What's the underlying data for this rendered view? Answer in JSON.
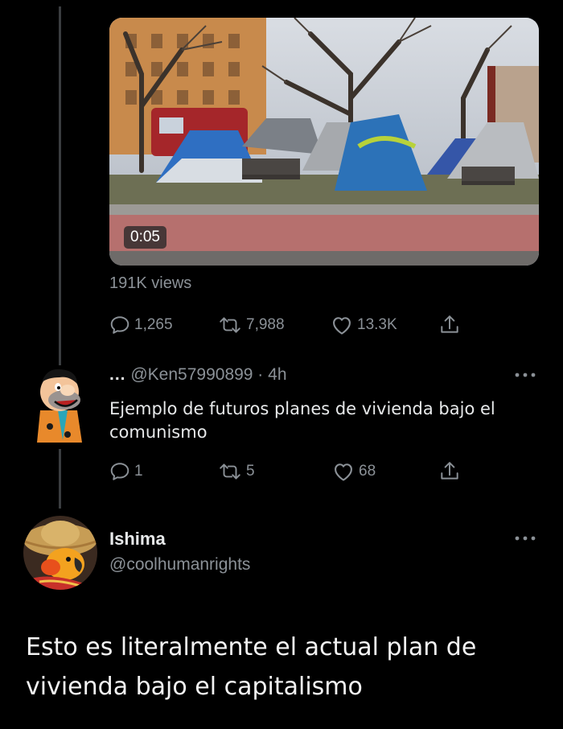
{
  "original_tweet": {
    "video": {
      "duration": "0:05",
      "views": "191K views"
    },
    "stats": {
      "replies": "1,265",
      "retweets": "7,988",
      "likes": "13.3K"
    }
  },
  "reply": {
    "prefix": "...",
    "handle_time": "@Ken57990899 · 4h",
    "text": "Ejemplo de futuros planes de vivienda bajo el comunismo",
    "stats": {
      "replies": "1",
      "retweets": "5",
      "likes": "68"
    }
  },
  "author": {
    "name": "Ishima",
    "handle": "@coolhumanrights"
  },
  "main_text": "Esto es literalmente el actual plan de vivienda bajo el capitalismo",
  "colors": {
    "background": "#000000",
    "text": "#e7e9ea",
    "muted": "#8b9197"
  }
}
